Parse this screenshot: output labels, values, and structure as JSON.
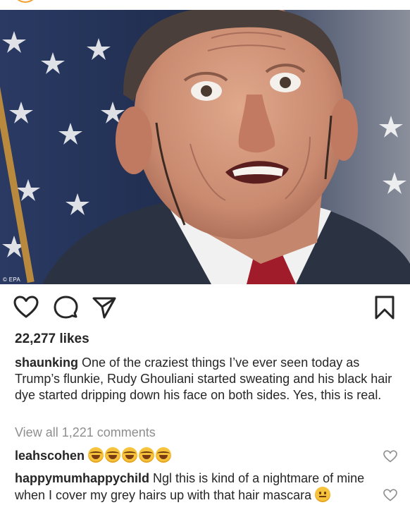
{
  "post": {
    "photo_credit": "© EPA",
    "likes": "22,277 likes",
    "caption_user": "shaunking",
    "caption_text": "One of the craziest things I’ve ever seen today as Trump’s flunkie, Rudy Ghouliani started sweating and his black hair dye started dripping down his face on both sides. Yes, this is real.",
    "view_all_comments": "View all 1,221 comments"
  },
  "comments": [
    {
      "user": "leahscohen",
      "text": "",
      "emojis": [
        "laughing-crying",
        "laughing-crying",
        "laughing-crying",
        "laughing-crying",
        "laughing-crying"
      ]
    },
    {
      "user": "happymumhappychild",
      "text": "Ngl this is kind of a nightmare of mine when I cover my grey hairs up with that hair mascara",
      "emojis": [
        "neutral-face"
      ]
    }
  ],
  "icons": {
    "like": "heart-icon",
    "comment": "comment-bubble-icon",
    "share": "paper-plane-icon",
    "save": "bookmark-icon",
    "comment_like": "heart-outline-icon"
  },
  "colors": {
    "text": "#262626",
    "muted": "#8e8e8e",
    "emoji": "#f7c23c"
  }
}
